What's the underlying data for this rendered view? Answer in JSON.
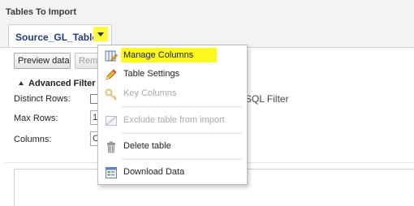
{
  "section": {
    "title": "Tables To Import"
  },
  "tab": {
    "label": "Source_GL_Table"
  },
  "toolbar": {
    "preview_label": "Preview data",
    "remove_label": "Remo"
  },
  "advanced": {
    "label": "Advanced Filter"
  },
  "fields": {
    "distinct_rows_label": "Distinct Rows:",
    "max_rows_label": "Max Rows:",
    "max_rows_value": "1",
    "columns_label": "Columns:",
    "columns_value": "C",
    "sql_filter_label": "er SQL Filter"
  },
  "menu": {
    "items": [
      {
        "label": "Manage Columns",
        "icon": "manage-columns-icon",
        "enabled": true,
        "highlighted": true
      },
      {
        "label": "Table Settings",
        "icon": "pencil-icon",
        "enabled": true
      },
      {
        "label": "Key Columns",
        "icon": "key-icon",
        "enabled": false
      },
      {
        "label": "Exclude table from import",
        "icon": "exclude-icon",
        "enabled": false
      },
      {
        "label": "Delete table",
        "icon": "trash-icon",
        "enabled": true
      },
      {
        "label": "Download Data",
        "icon": "download-icon",
        "enabled": true
      }
    ]
  },
  "colors": {
    "highlight": "#fbf81f",
    "tab_text": "#1f3f73"
  }
}
